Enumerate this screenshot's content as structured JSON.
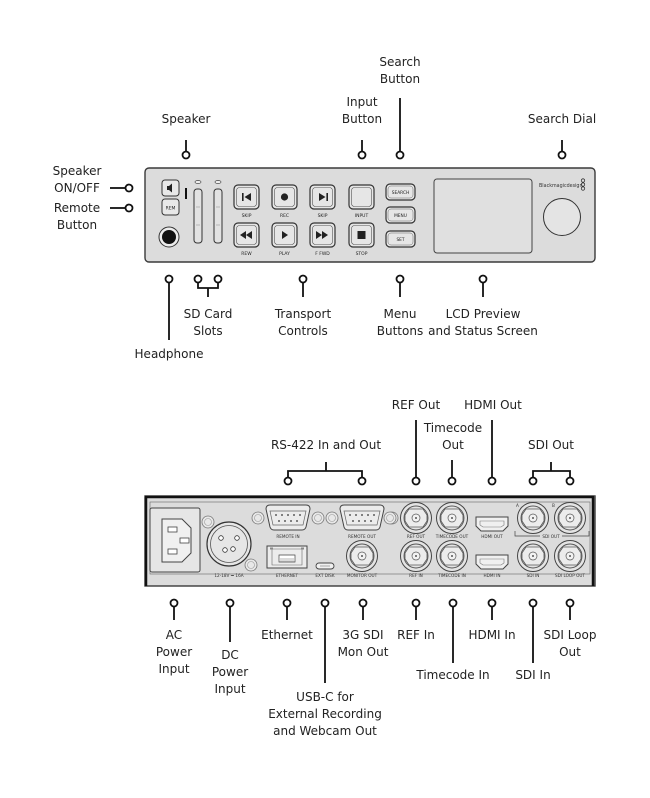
{
  "front_panel": {
    "callouts": {
      "speaker": "Speaker",
      "search_button": "Search\nButton",
      "input_button": "Input\nButton",
      "search_dial": "Search Dial",
      "speaker_on_off": "Speaker\nON/OFF",
      "remote_button": "Remote\nButton",
      "headphone": "Headphone",
      "sd_card_slots": "SD Card\nSlots",
      "transport_controls": "Transport\nControls",
      "menu_buttons": "Menu\nButtons",
      "lcd_preview": "LCD Preview\nand Status Screen"
    },
    "device": {
      "brand": "Blackmagicdesign",
      "rem_button": "REM",
      "transport_top": [
        {
          "label": "SKIP",
          "icon": "skip-back-icon"
        },
        {
          "label": "REC",
          "icon": "record-icon"
        },
        {
          "label": "SKIP",
          "icon": "skip-forward-icon"
        },
        {
          "label": "INPUT",
          "icon": "none"
        }
      ],
      "transport_bottom": [
        {
          "label": "REW",
          "icon": "rewind-icon"
        },
        {
          "label": "PLAY",
          "icon": "play-icon"
        },
        {
          "label": "F FWD",
          "icon": "fast-forward-icon"
        },
        {
          "label": "STOP",
          "icon": "stop-icon"
        }
      ],
      "menu_buttons": [
        "SEARCH",
        "MENU",
        "SET"
      ]
    }
  },
  "rear_panel": {
    "callouts_top": {
      "rs422": "RS-422 In and Out",
      "ref_out": "REF Out",
      "timecode_out": "Timecode\nOut",
      "hdmi_out": "HDMI Out",
      "sdi_out": "SDI Out"
    },
    "callouts_bottom": {
      "ac_power": "AC\nPower\nInput",
      "dc_power": "DC\nPower\nInput",
      "ethernet": "Ethernet",
      "usb_c": "USB-C for\nExternal Recording\nand Webcam Out",
      "sdi_mon_out": "3G SDI\nMon Out",
      "ref_in": "REF In",
      "timecode_in": "Timecode In",
      "hdmi_in": "HDMI In",
      "sdi_in": "SDI In",
      "sdi_loop_out": "SDI Loop\nOut"
    },
    "device": {
      "dc_rating": "12-18V ⎓ 16A",
      "remote_in": "REMOTE IN",
      "remote_out": "REMOTE OUT",
      "ethernet": "ETHERNET",
      "ext_disk": "EXT DISK",
      "monitor_out": "MONITOR OUT",
      "ref_out": "REF OUT",
      "timecode_out": "TIMECODE OUT",
      "hdmi_out": "HDMI OUT",
      "sdi_out": "SDI OUT",
      "sdi_a": "A",
      "sdi_b": "B",
      "ref_in": "REF IN",
      "timecode_in": "TIMECODE IN",
      "hdmi_in": "HDMI IN",
      "sdi_in": "SDI IN",
      "sdi_loop_out": "SDI LOOP OUT"
    }
  },
  "colors": {
    "device_body": "#dcdcdc",
    "outline": "#3a3a3a",
    "leader": "#111111",
    "text": "#222222"
  }
}
